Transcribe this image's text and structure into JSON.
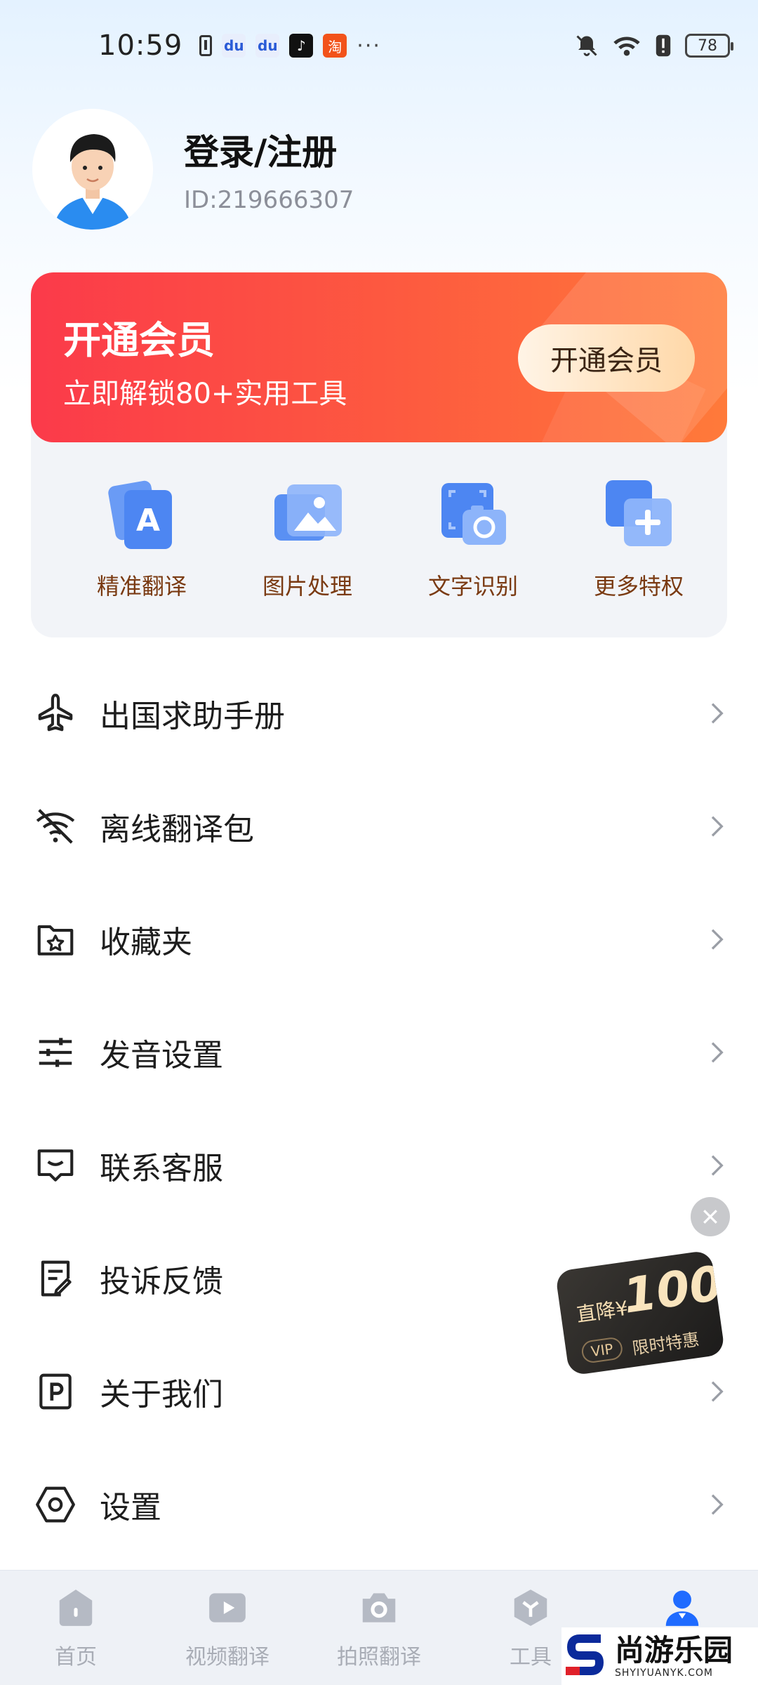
{
  "status_bar": {
    "time": "10:59",
    "more": "···",
    "battery": "78"
  },
  "profile": {
    "name": "登录/注册",
    "id_text": "ID:219666307"
  },
  "vip": {
    "title": "开通会员",
    "subtitle": "立即解锁80+实用工具",
    "button_label": "开通会员",
    "perks": [
      {
        "label": "精准翻译",
        "icon": "translate-a-icon"
      },
      {
        "label": "图片处理",
        "icon": "image-icon"
      },
      {
        "label": "文字识别",
        "icon": "ocr-camera-icon"
      },
      {
        "label": "更多特权",
        "icon": "plus-cards-icon"
      }
    ]
  },
  "menu": [
    {
      "label": "出国求助手册",
      "icon": "airplane-icon"
    },
    {
      "label": "离线翻译包",
      "icon": "wifi-off-icon"
    },
    {
      "label": "收藏夹",
      "icon": "folder-star-icon"
    },
    {
      "label": "发音设置",
      "icon": "sliders-icon"
    },
    {
      "label": "联系客服",
      "icon": "chat-message-icon"
    },
    {
      "label": "投诉反馈",
      "icon": "edit-document-icon"
    },
    {
      "label": "关于我们",
      "icon": "p-document-icon"
    },
    {
      "label": "设置",
      "icon": "hexagon-settings-icon"
    }
  ],
  "promo": {
    "prefix": "直降¥",
    "amount": "100",
    "vip": "VIP",
    "tag": "限时特惠"
  },
  "tabbar": [
    {
      "label": "首页",
      "icon": "home-icon",
      "active": false
    },
    {
      "label": "视频翻译",
      "icon": "video-play-icon",
      "active": false
    },
    {
      "label": "拍照翻译",
      "icon": "camera-icon",
      "active": false
    },
    {
      "label": "工具",
      "icon": "tools-cube-icon",
      "active": false
    },
    {
      "label": "",
      "icon": "profile-icon",
      "active": true
    }
  ],
  "watermark": {
    "main": "尚游乐园",
    "sub": "SHYIYUANYK.COM"
  },
  "colors": {
    "accent_blue": "#1f6bff",
    "vip_red": "#fb3a4a",
    "perk_label": "#7a3a12"
  }
}
